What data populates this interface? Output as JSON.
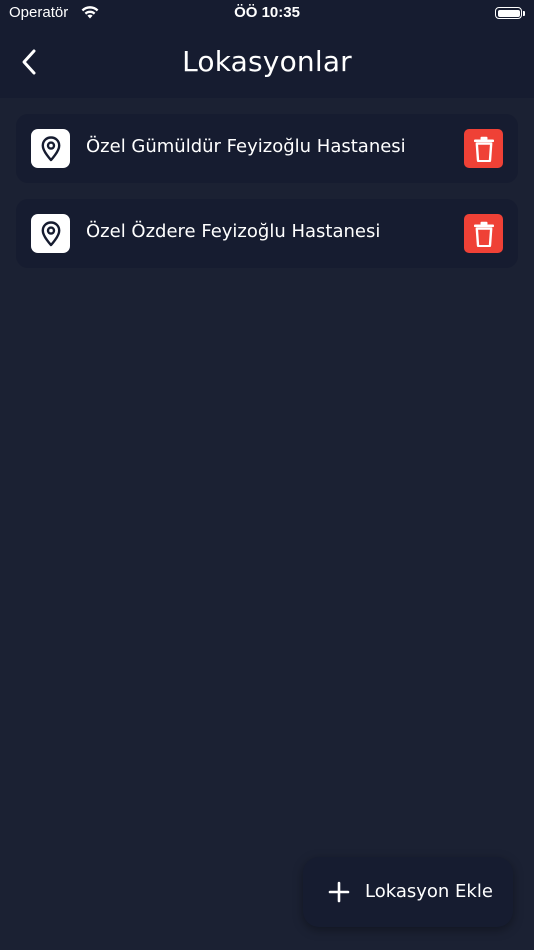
{
  "status_bar": {
    "carrier": "Operatör",
    "time": "ÖÖ 10:35",
    "battery_level": 1.0
  },
  "header": {
    "title": "Lokasyonlar"
  },
  "locations": [
    {
      "name": "Özel Gümüldür Feyizoğlu Hastanesi"
    },
    {
      "name": "Özel Özdere Feyizoğlu Hastanesi"
    }
  ],
  "fab": {
    "label": "Lokasyon Ekle"
  },
  "colors": {
    "background": "#1b2133",
    "header": "#161c30",
    "card": "#161c30",
    "delete": "#ef4136",
    "text": "#ffffff"
  },
  "icons": {
    "back": "chevron-left-icon",
    "location": "map-pin-icon",
    "delete": "trash-icon",
    "add": "plus-icon",
    "wifi": "wifi-icon",
    "battery": "battery-icon"
  }
}
